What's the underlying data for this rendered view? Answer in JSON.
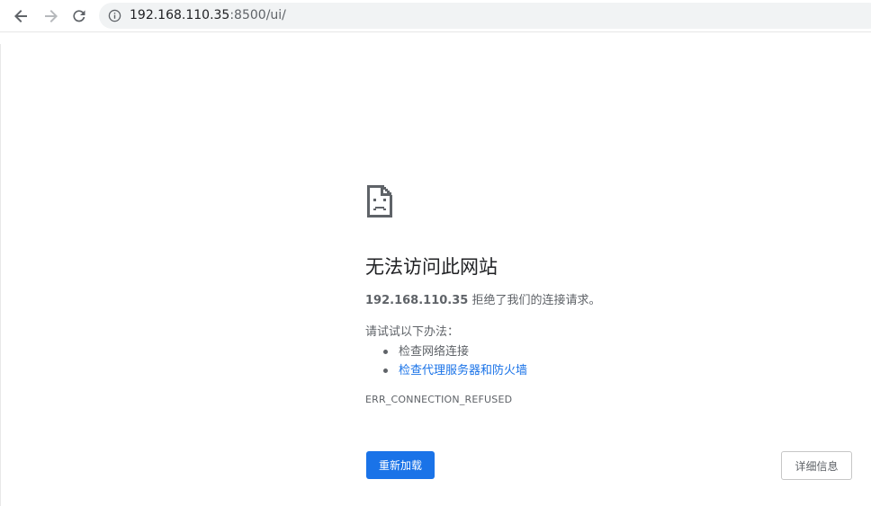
{
  "browser": {
    "url_host": "192.168.110.35",
    "url_rest": ":8500/ui/",
    "icons": {
      "back": "back-arrow-icon",
      "forward": "forward-arrow-icon",
      "reload": "reload-icon",
      "site_info": "info-icon"
    }
  },
  "error": {
    "icon": "sad-page-icon",
    "title": "无法访问此网站",
    "host": "192.168.110.35",
    "description_suffix": " 拒绝了我们的连接请求。",
    "suggestions_header": "请试试以下办法：",
    "suggestions": [
      {
        "label": "检查网络连接",
        "is_link": false
      },
      {
        "label": "检查代理服务器和防火墙",
        "is_link": true
      }
    ],
    "code": "ERR_CONNECTION_REFUSED",
    "reload_label": "重新加载",
    "details_label": "详细信息"
  },
  "colors": {
    "primary": "#1a73e8",
    "text": "#5f6368",
    "title": "#202124"
  }
}
